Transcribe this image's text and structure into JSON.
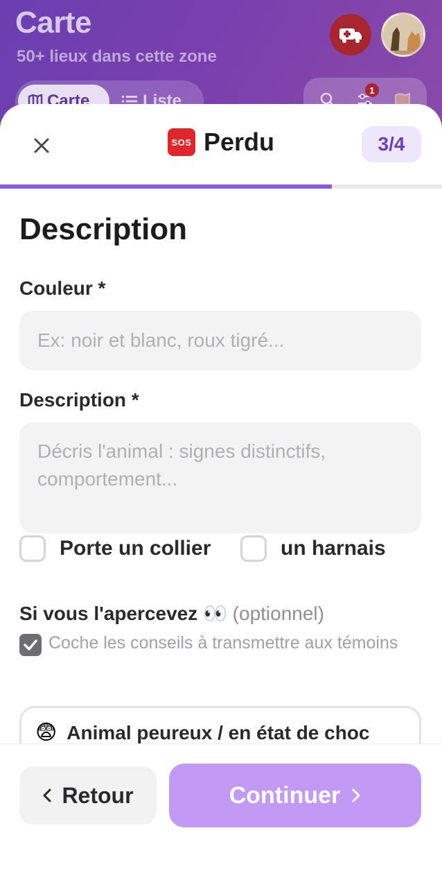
{
  "background": {
    "title": "Carte",
    "subtitle": "50+ lieux dans cette zone",
    "view_toggle": {
      "active_label": "Carte",
      "inactive_label": "Liste"
    },
    "filter_badge_count": "1"
  },
  "sheet": {
    "title": "Perdu",
    "sos_label": "SOS",
    "step": "3/4",
    "progress": 0.75
  },
  "form": {
    "section_title": "Description",
    "color_label": "Couleur *",
    "color_placeholder": "Ex: noir et blanc, roux tigré...",
    "description_label": "Description *",
    "description_placeholder": "Décris l'animal : signes distinctifs, comportement...",
    "collar_label": "Porte un collier",
    "harness_label": "un harnais",
    "sighting_title": "Si vous l'apercevez 👀",
    "sighting_optional": "(optionnel)",
    "sighting_hint": "Coche les conseils à transmettre aux témoins",
    "advice_items": [
      {
        "emoji": "😨",
        "text": "Animal peureux / en état de choc"
      }
    ]
  },
  "footer": {
    "back_label": "Retour",
    "continue_label": "Continuer"
  },
  "colors": {
    "accent": "#8a5ae0",
    "continue_bg": "#c29af5",
    "step_badge_bg": "#eee6fb",
    "sos_red": "#e0252b"
  }
}
